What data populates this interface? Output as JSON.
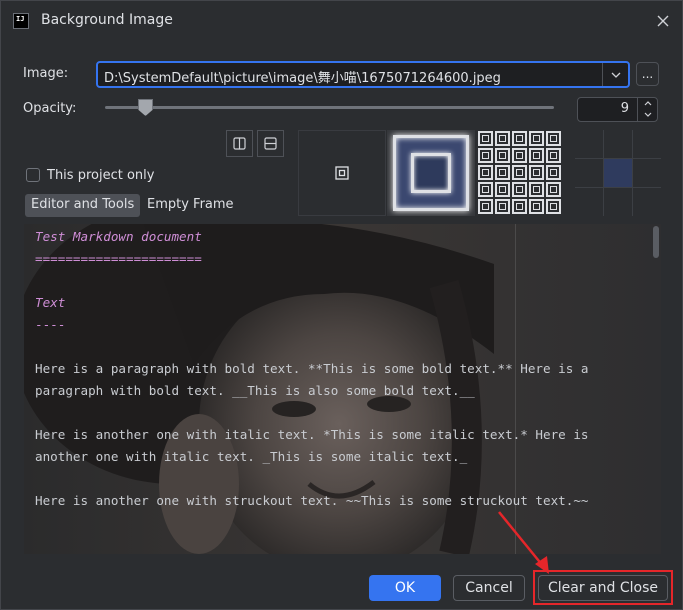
{
  "dialog": {
    "title": "Background Image",
    "app_icon_text": "IJ"
  },
  "image": {
    "label": "Image:",
    "path": "D:\\SystemDefault\\picture\\image\\舞小喵\\1675071264600.jpeg",
    "browse_label": "..."
  },
  "opacity": {
    "label": "Opacity:",
    "value": "9",
    "slider_fraction": 0.09
  },
  "options": {
    "this_project_only": "This project only",
    "this_project_only_checked": false
  },
  "targets": {
    "tabs": [
      "Editor and Tools",
      "Empty Frame"
    ],
    "selected": "Editor and Tools"
  },
  "fill_modes": [
    "plain",
    "scale",
    "tile",
    "center"
  ],
  "selected_anchor": "center",
  "preview": {
    "lines": [
      "Test Markdown document",
      "======================",
      "",
      "Text",
      "----",
      "",
      "Here is a paragraph with bold text. **This is some bold text.** Here is a",
      "paragraph with bold text. __This is also some bold text.__",
      "",
      "Here is another one with italic text. *This is some italic text.* Here is",
      "another one with italic text. _This is some italic text._",
      "",
      "Here is another one with struckout text. ~~This is some struckout text.~~"
    ]
  },
  "buttons": {
    "ok": "OK",
    "cancel": "Cancel",
    "clear_and_close": "Clear and Close"
  },
  "colors": {
    "accent": "#3574f0",
    "background": "#2b2d30",
    "annotation": "#e5262a"
  }
}
